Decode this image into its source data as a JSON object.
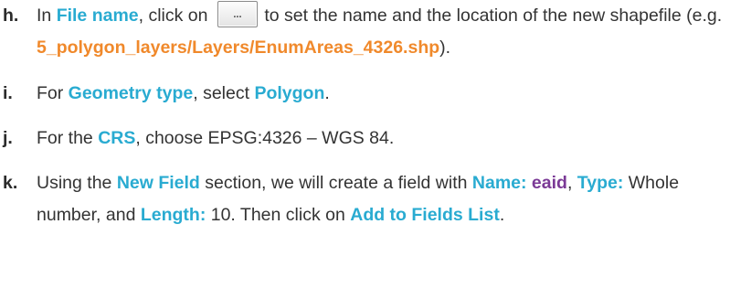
{
  "steps": [
    {
      "marker": "h.",
      "t1": "In ",
      "k1": "File name",
      "t2": ", click on ",
      "button_label": "...",
      "t3": " to set the name and the location of the new shapefile (e.g. ",
      "path": "5_polygon_layers/Layers/EnumAreas_4326.shp",
      "t4": ")."
    },
    {
      "marker": "i.",
      "t1": "For ",
      "k1": "Geometry type",
      "t2": ", select ",
      "k2": "Polygon",
      "t3": "."
    },
    {
      "marker": "j.",
      "t1": "For the ",
      "k1": "CRS",
      "t2": ", choose EPSG:4326 – WGS 84."
    },
    {
      "marker": "k.",
      "t1": "Using the ",
      "k1": "New Field",
      "t2": " section, we will create a field with ",
      "k2": "Name:",
      "v1": "eaid",
      "t3": ", ",
      "k3": "Type:",
      "t4": " Whole number, and ",
      "k4": "Length:",
      "t5": " 10. Then click on ",
      "k5": "Add to Fields List",
      "t6": "."
    }
  ],
  "colors": {
    "keyword": "#29abd1",
    "path": "#f0892b",
    "value": "#7b3a96",
    "text": "#333333"
  }
}
